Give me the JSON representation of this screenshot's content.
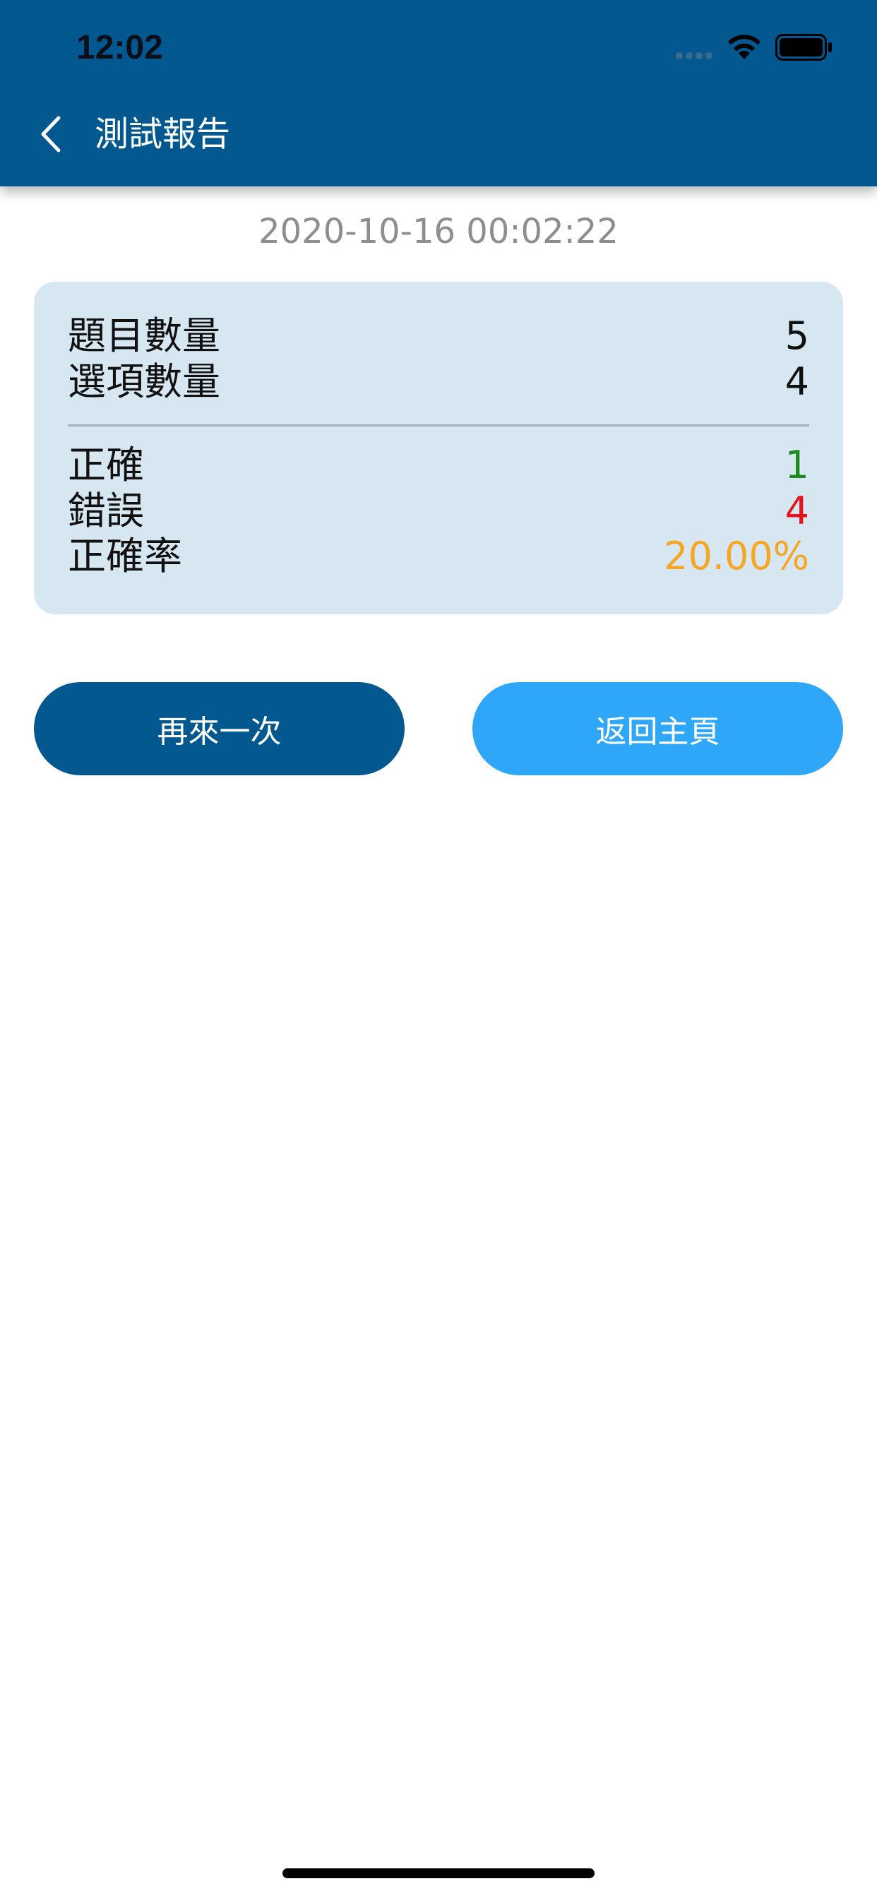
{
  "status_bar": {
    "time": "12:02",
    "icons": [
      "signal-dots-icon",
      "wifi-icon",
      "battery-icon"
    ]
  },
  "nav": {
    "back_icon": "chevron-left-icon",
    "title": "測試報告"
  },
  "timestamp": "2020-10-16 00:02:22",
  "summary": {
    "question_count_label": "題目數量",
    "question_count_value": "5",
    "option_count_label": "選項數量",
    "option_count_value": "4",
    "correct_label": "正確",
    "correct_value": "1",
    "wrong_label": "錯誤",
    "wrong_value": "4",
    "accuracy_label": "正確率",
    "accuracy_value": "20.00%"
  },
  "buttons": {
    "retry_label": "再來一次",
    "home_label": "返回主頁"
  },
  "colors": {
    "header": "#03588f",
    "card": "#d7e7f2",
    "correct": "#1e8b1e",
    "wrong": "#e8141c",
    "accuracy": "#f5a623",
    "retry_button": "#03588f",
    "home_button": "#2ea7f9"
  }
}
